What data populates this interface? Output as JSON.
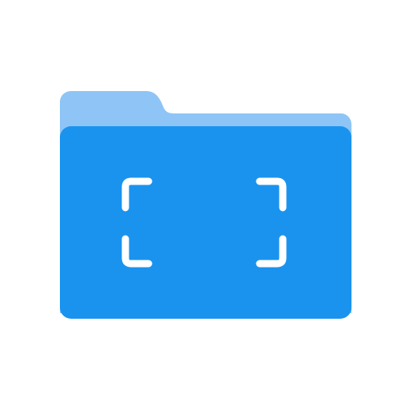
{
  "icon": {
    "name": "folder-scan-icon",
    "parts": [
      "folder-back-icon",
      "folder-front-icon",
      "scan-frame-icon"
    ]
  },
  "colors": {
    "background": "#ffffff",
    "folder_back": "#8ec5f6",
    "folder_front": "#1a93ef",
    "scan_frame": "#ffffff"
  }
}
